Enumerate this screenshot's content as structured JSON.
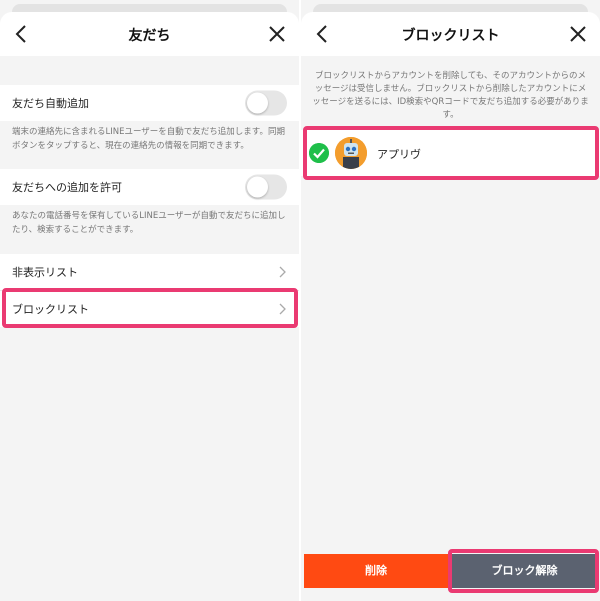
{
  "left": {
    "title": "友だち",
    "settings": [
      {
        "label": "友だち自動追加",
        "toggle": false,
        "description": "端末の連絡先に含まれるLINEユーザーを自動で友だち追加します。同期ボタンをタップすると、現在の連絡先の情報を同期できます。"
      },
      {
        "label": "友だちへの追加を許可",
        "toggle": false,
        "description": "あなたの電話番号を保有しているLINEユーザーが自動で友だちに追加したり、検索することができます。"
      }
    ],
    "links": [
      {
        "label": "非表示リスト"
      },
      {
        "label": "ブロックリスト"
      }
    ]
  },
  "right": {
    "title": "ブロックリスト",
    "info": "ブロックリストからアカウントを削除しても、そのアカウントからのメッセージは受信しません。ブロックリストから削除したアカウントにメッセージを送るには、ID検索やQRコードで友だち追加する必要があります。",
    "blocked": [
      {
        "name": "アプリヴ",
        "selected": true
      }
    ],
    "delete_label": "削除",
    "unblock_label": "ブロック解除"
  },
  "colors": {
    "highlight": "#ea3a72",
    "delete": "#ff4a12",
    "unblock": "#5b6270",
    "check": "#1fbf4a"
  }
}
